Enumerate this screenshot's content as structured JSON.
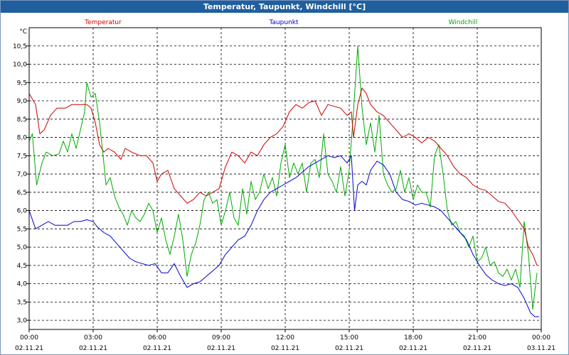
{
  "window": {
    "title": "Temperatur, Taupunkt, Windchill [°C]"
  },
  "chart_data": {
    "type": "line",
    "ylabel": "°C",
    "ylim": [
      2.75,
      11.0
    ],
    "y_ticks": [
      "3,0",
      "3,5",
      "4,0",
      "4,5",
      "5,0",
      "5,5",
      "6,0",
      "6,5",
      "7,0",
      "7,5",
      "8,0",
      "8,5",
      "9,0",
      "9,5",
      "10,0",
      "10,5"
    ],
    "y_tick_values": [
      3.0,
      3.5,
      4.0,
      4.5,
      5.0,
      5.5,
      6.0,
      6.5,
      7.0,
      7.5,
      8.0,
      8.5,
      9.0,
      9.5,
      10.0,
      10.5
    ],
    "x_range_hours": [
      0,
      24
    ],
    "x_ticks": [
      {
        "h": 0,
        "time": "00:00",
        "date": "02.11.21"
      },
      {
        "h": 3,
        "time": "03:00",
        "date": "02.11.21"
      },
      {
        "h": 6,
        "time": "06:00",
        "date": "02.11.21"
      },
      {
        "h": 9,
        "time": "09:00",
        "date": "02.11.21"
      },
      {
        "h": 12,
        "time": "12:00",
        "date": "02.11.21"
      },
      {
        "h": 15,
        "time": "15:00",
        "date": "02.11.21"
      },
      {
        "h": 18,
        "time": "18:00",
        "date": "02.11.21"
      },
      {
        "h": 21,
        "time": "21:00",
        "date": "02.11.21"
      },
      {
        "h": 24,
        "time": "00:00",
        "date": "03.11.21"
      }
    ],
    "grid": true,
    "legend_placement": "top",
    "series": [
      {
        "name": "Temperatur",
        "color": "#cc0000",
        "points": [
          [
            0.0,
            9.2
          ],
          [
            0.3,
            8.9
          ],
          [
            0.5,
            8.1
          ],
          [
            0.7,
            8.2
          ],
          [
            1.0,
            8.6
          ],
          [
            1.3,
            8.8
          ],
          [
            1.7,
            8.8
          ],
          [
            2.0,
            8.9
          ],
          [
            2.3,
            8.9
          ],
          [
            2.7,
            8.9
          ],
          [
            2.9,
            8.8
          ],
          [
            3.1,
            8.4
          ],
          [
            3.3,
            7.8
          ],
          [
            3.5,
            7.6
          ],
          [
            3.7,
            7.7
          ],
          [
            4.0,
            7.6
          ],
          [
            4.3,
            7.4
          ],
          [
            4.5,
            7.7
          ],
          [
            4.8,
            7.6
          ],
          [
            5.2,
            7.5
          ],
          [
            5.5,
            7.5
          ],
          [
            5.8,
            7.3
          ],
          [
            6.0,
            6.8
          ],
          [
            6.2,
            7.0
          ],
          [
            6.5,
            7.1
          ],
          [
            6.8,
            6.6
          ],
          [
            7.1,
            6.4
          ],
          [
            7.4,
            6.2
          ],
          [
            7.7,
            6.3
          ],
          [
            8.0,
            6.5
          ],
          [
            8.3,
            6.4
          ],
          [
            8.6,
            6.5
          ],
          [
            8.9,
            6.6
          ],
          [
            9.2,
            7.2
          ],
          [
            9.5,
            7.6
          ],
          [
            9.8,
            7.5
          ],
          [
            10.1,
            7.3
          ],
          [
            10.4,
            7.6
          ],
          [
            10.7,
            7.5
          ],
          [
            11.0,
            7.8
          ],
          [
            11.3,
            8.0
          ],
          [
            11.6,
            8.1
          ],
          [
            11.9,
            8.3
          ],
          [
            12.2,
            8.7
          ],
          [
            12.5,
            8.9
          ],
          [
            12.8,
            8.8
          ],
          [
            13.1,
            8.95
          ],
          [
            13.4,
            9.0
          ],
          [
            13.7,
            8.6
          ],
          [
            14.0,
            8.9
          ],
          [
            14.3,
            8.85
          ],
          [
            14.6,
            8.8
          ],
          [
            14.9,
            8.6
          ],
          [
            15.1,
            8.7
          ],
          [
            15.2,
            8.0
          ],
          [
            15.4,
            8.9
          ],
          [
            15.6,
            9.35
          ],
          [
            15.8,
            9.2
          ],
          [
            16.0,
            8.9
          ],
          [
            16.3,
            8.7
          ],
          [
            16.6,
            8.6
          ],
          [
            16.9,
            8.4
          ],
          [
            17.2,
            8.2
          ],
          [
            17.5,
            8.0
          ],
          [
            17.8,
            8.1
          ],
          [
            18.1,
            8.0
          ],
          [
            18.4,
            7.85
          ],
          [
            18.7,
            8.0
          ],
          [
            19.0,
            7.9
          ],
          [
            19.3,
            7.7
          ],
          [
            19.6,
            7.5
          ],
          [
            19.9,
            7.2
          ],
          [
            20.2,
            7.0
          ],
          [
            20.5,
            6.9
          ],
          [
            20.8,
            6.7
          ],
          [
            21.1,
            6.6
          ],
          [
            21.4,
            6.55
          ],
          [
            21.7,
            6.4
          ],
          [
            22.0,
            6.25
          ],
          [
            22.3,
            6.2
          ],
          [
            22.6,
            6.0
          ],
          [
            22.9,
            5.75
          ],
          [
            23.2,
            5.5
          ],
          [
            23.4,
            5.0
          ],
          [
            23.6,
            4.8
          ],
          [
            23.8,
            4.5
          ]
        ]
      },
      {
        "name": "Taupunkt",
        "color": "#0000cc",
        "points": [
          [
            0.0,
            6.0
          ],
          [
            0.3,
            5.5
          ],
          [
            0.6,
            5.6
          ],
          [
            0.9,
            5.7
          ],
          [
            1.2,
            5.6
          ],
          [
            1.5,
            5.6
          ],
          [
            1.8,
            5.6
          ],
          [
            2.1,
            5.7
          ],
          [
            2.4,
            5.7
          ],
          [
            2.7,
            5.75
          ],
          [
            3.0,
            5.7
          ],
          [
            3.2,
            5.55
          ],
          [
            3.5,
            5.4
          ],
          [
            3.8,
            5.3
          ],
          [
            4.1,
            5.1
          ],
          [
            4.4,
            4.9
          ],
          [
            4.7,
            4.7
          ],
          [
            5.0,
            4.6
          ],
          [
            5.3,
            4.55
          ],
          [
            5.6,
            4.5
          ],
          [
            5.9,
            4.55
          ],
          [
            6.2,
            4.3
          ],
          [
            6.5,
            4.3
          ],
          [
            6.8,
            4.55
          ],
          [
            7.1,
            4.2
          ],
          [
            7.4,
            3.9
          ],
          [
            7.7,
            4.0
          ],
          [
            8.0,
            4.05
          ],
          [
            8.3,
            4.2
          ],
          [
            8.6,
            4.35
          ],
          [
            8.9,
            4.5
          ],
          [
            9.2,
            4.8
          ],
          [
            9.5,
            5.0
          ],
          [
            9.8,
            5.2
          ],
          [
            10.1,
            5.3
          ],
          [
            10.4,
            5.6
          ],
          [
            10.7,
            6.0
          ],
          [
            11.0,
            6.3
          ],
          [
            11.3,
            6.5
          ],
          [
            11.6,
            6.6
          ],
          [
            11.9,
            6.7
          ],
          [
            12.2,
            6.8
          ],
          [
            12.5,
            6.9
          ],
          [
            12.8,
            7.05
          ],
          [
            13.1,
            7.2
          ],
          [
            13.4,
            7.3
          ],
          [
            13.7,
            7.4
          ],
          [
            14.0,
            7.5
          ],
          [
            14.3,
            7.45
          ],
          [
            14.6,
            7.5
          ],
          [
            14.9,
            7.3
          ],
          [
            15.1,
            7.5
          ],
          [
            15.25,
            6.0
          ],
          [
            15.4,
            6.7
          ],
          [
            15.6,
            6.8
          ],
          [
            15.8,
            6.7
          ],
          [
            16.0,
            7.1
          ],
          [
            16.3,
            7.35
          ],
          [
            16.6,
            7.25
          ],
          [
            16.9,
            7.0
          ],
          [
            17.2,
            6.5
          ],
          [
            17.5,
            6.3
          ],
          [
            17.8,
            6.25
          ],
          [
            18.1,
            6.15
          ],
          [
            18.4,
            6.2
          ],
          [
            18.7,
            6.15
          ],
          [
            19.0,
            6.1
          ],
          [
            19.3,
            6.0
          ],
          [
            19.6,
            5.8
          ],
          [
            19.9,
            5.6
          ],
          [
            20.2,
            5.4
          ],
          [
            20.5,
            5.2
          ],
          [
            20.8,
            4.8
          ],
          [
            21.1,
            4.5
          ],
          [
            21.4,
            4.25
          ],
          [
            21.7,
            4.1
          ],
          [
            22.0,
            4.0
          ],
          [
            22.3,
            3.95
          ],
          [
            22.6,
            4.0
          ],
          [
            22.9,
            3.9
          ],
          [
            23.2,
            3.6
          ],
          [
            23.5,
            3.2
          ],
          [
            23.7,
            3.1
          ],
          [
            23.9,
            3.1
          ]
        ]
      },
      {
        "name": "Windchill",
        "color": "#00aa00",
        "points": [
          [
            0.0,
            7.9
          ],
          [
            0.15,
            8.1
          ],
          [
            0.35,
            6.7
          ],
          [
            0.6,
            7.3
          ],
          [
            0.8,
            7.6
          ],
          [
            1.1,
            7.5
          ],
          [
            1.4,
            7.55
          ],
          [
            1.6,
            7.9
          ],
          [
            1.8,
            7.6
          ],
          [
            2.0,
            8.1
          ],
          [
            2.2,
            7.7
          ],
          [
            2.4,
            8.2
          ],
          [
            2.6,
            8.7
          ],
          [
            2.7,
            9.5
          ],
          [
            2.9,
            9.1
          ],
          [
            3.1,
            9.2
          ],
          [
            3.3,
            8.4
          ],
          [
            3.5,
            7.3
          ],
          [
            3.6,
            6.7
          ],
          [
            3.8,
            6.9
          ],
          [
            4.0,
            6.4
          ],
          [
            4.2,
            6.1
          ],
          [
            4.4,
            5.9
          ],
          [
            4.6,
            5.6
          ],
          [
            4.8,
            6.0
          ],
          [
            5.0,
            5.8
          ],
          [
            5.2,
            5.7
          ],
          [
            5.4,
            5.9
          ],
          [
            5.6,
            6.2
          ],
          [
            5.8,
            6.0
          ],
          [
            6.0,
            5.4
          ],
          [
            6.2,
            5.8
          ],
          [
            6.4,
            5.2
          ],
          [
            6.6,
            4.8
          ],
          [
            6.8,
            5.3
          ],
          [
            7.0,
            5.9
          ],
          [
            7.2,
            5.2
          ],
          [
            7.4,
            4.2
          ],
          [
            7.6,
            4.8
          ],
          [
            7.8,
            5.1
          ],
          [
            8.0,
            5.6
          ],
          [
            8.2,
            6.3
          ],
          [
            8.4,
            6.5
          ],
          [
            8.6,
            6.2
          ],
          [
            8.8,
            6.3
          ],
          [
            9.0,
            5.6
          ],
          [
            9.2,
            6.0
          ],
          [
            9.4,
            6.5
          ],
          [
            9.6,
            5.8
          ],
          [
            9.8,
            5.6
          ],
          [
            10.0,
            6.6
          ],
          [
            10.2,
            5.9
          ],
          [
            10.4,
            6.8
          ],
          [
            10.6,
            6.3
          ],
          [
            10.8,
            6.5
          ],
          [
            11.0,
            7.0
          ],
          [
            11.2,
            6.6
          ],
          [
            11.4,
            6.9
          ],
          [
            11.6,
            6.4
          ],
          [
            11.8,
            7.3
          ],
          [
            12.0,
            7.8
          ],
          [
            12.2,
            6.9
          ],
          [
            12.4,
            7.3
          ],
          [
            12.6,
            7.0
          ],
          [
            12.8,
            7.3
          ],
          [
            13.0,
            6.5
          ],
          [
            13.2,
            7.3
          ],
          [
            13.4,
            7.4
          ],
          [
            13.6,
            6.9
          ],
          [
            13.8,
            8.1
          ],
          [
            14.0,
            7.0
          ],
          [
            14.2,
            6.8
          ],
          [
            14.4,
            6.5
          ],
          [
            14.6,
            7.2
          ],
          [
            14.8,
            6.4
          ],
          [
            15.0,
            7.1
          ],
          [
            15.2,
            8.7
          ],
          [
            15.4,
            10.5
          ],
          [
            15.6,
            8.8
          ],
          [
            15.8,
            7.8
          ],
          [
            16.0,
            8.4
          ],
          [
            16.2,
            7.6
          ],
          [
            16.4,
            8.6
          ],
          [
            16.6,
            7.0
          ],
          [
            16.8,
            6.7
          ],
          [
            17.0,
            6.5
          ],
          [
            17.2,
            6.6
          ],
          [
            17.4,
            7.1
          ],
          [
            17.6,
            6.5
          ],
          [
            17.8,
            6.9
          ],
          [
            18.0,
            6.3
          ],
          [
            18.2,
            6.7
          ],
          [
            18.4,
            6.5
          ],
          [
            18.6,
            6.5
          ],
          [
            18.8,
            6.1
          ],
          [
            19.0,
            7.5
          ],
          [
            19.2,
            7.8
          ],
          [
            19.4,
            7.0
          ],
          [
            19.6,
            6.0
          ],
          [
            19.8,
            5.6
          ],
          [
            20.0,
            5.7
          ],
          [
            20.2,
            5.4
          ],
          [
            20.4,
            5.3
          ],
          [
            20.6,
            5.0
          ],
          [
            20.8,
            5.3
          ],
          [
            21.0,
            4.6
          ],
          [
            21.2,
            4.7
          ],
          [
            21.4,
            5.0
          ],
          [
            21.6,
            4.5
          ],
          [
            21.8,
            4.6
          ],
          [
            22.0,
            4.3
          ],
          [
            22.2,
            4.2
          ],
          [
            22.4,
            4.4
          ],
          [
            22.6,
            4.1
          ],
          [
            22.8,
            4.4
          ],
          [
            23.0,
            3.9
          ],
          [
            23.2,
            5.7
          ],
          [
            23.4,
            4.8
          ],
          [
            23.6,
            3.3
          ],
          [
            23.8,
            4.3
          ]
        ]
      }
    ]
  }
}
